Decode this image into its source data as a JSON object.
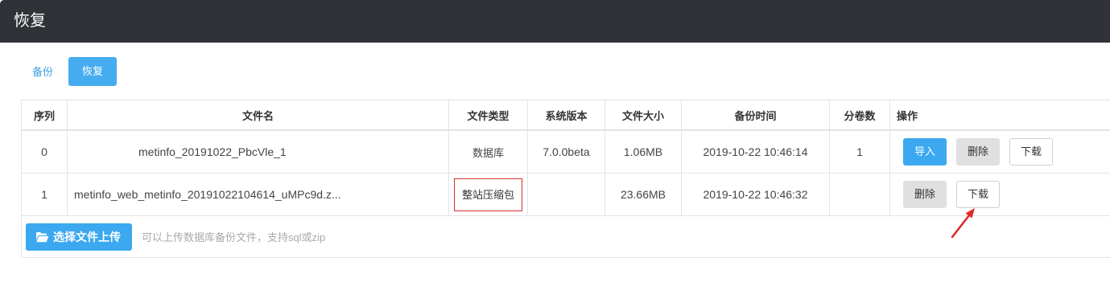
{
  "header": {
    "title": "恢复"
  },
  "tabs": [
    {
      "label": "备份",
      "active": false
    },
    {
      "label": "恢复",
      "active": true
    }
  ],
  "table": {
    "columns": [
      "序列",
      "文件名",
      "文件类型",
      "系统版本",
      "文件大小",
      "备份时间",
      "分卷数",
      "操作"
    ],
    "rows": [
      {
        "index": "0",
        "filename": "metinfo_20191022_PbcVle_1",
        "type": "数据库",
        "version": "7.0.0beta",
        "size": "1.06MB",
        "time": "2019-10-22 10:46:14",
        "volumes": "1",
        "actions": [
          "导入",
          "删除",
          "下载"
        ]
      },
      {
        "index": "1",
        "filename": "metinfo_web_metinfo_20191022104614_uMPc9d.z...",
        "type": "整站压缩包",
        "version": "",
        "size": "23.66MB",
        "time": "2019-10-22 10:46:32",
        "volumes": "",
        "actions": [
          "删除",
          "下载"
        ]
      }
    ]
  },
  "upload": {
    "button_label": "选择文件上传",
    "icon": "folder-open-icon",
    "hint": "可以上传数据库备份文件，支持sql或zip"
  },
  "colors": {
    "topbar": "#2f3237",
    "primary": "#3ba8f0",
    "gray_button": "#e0e0e0",
    "annotation": "#d63030"
  }
}
